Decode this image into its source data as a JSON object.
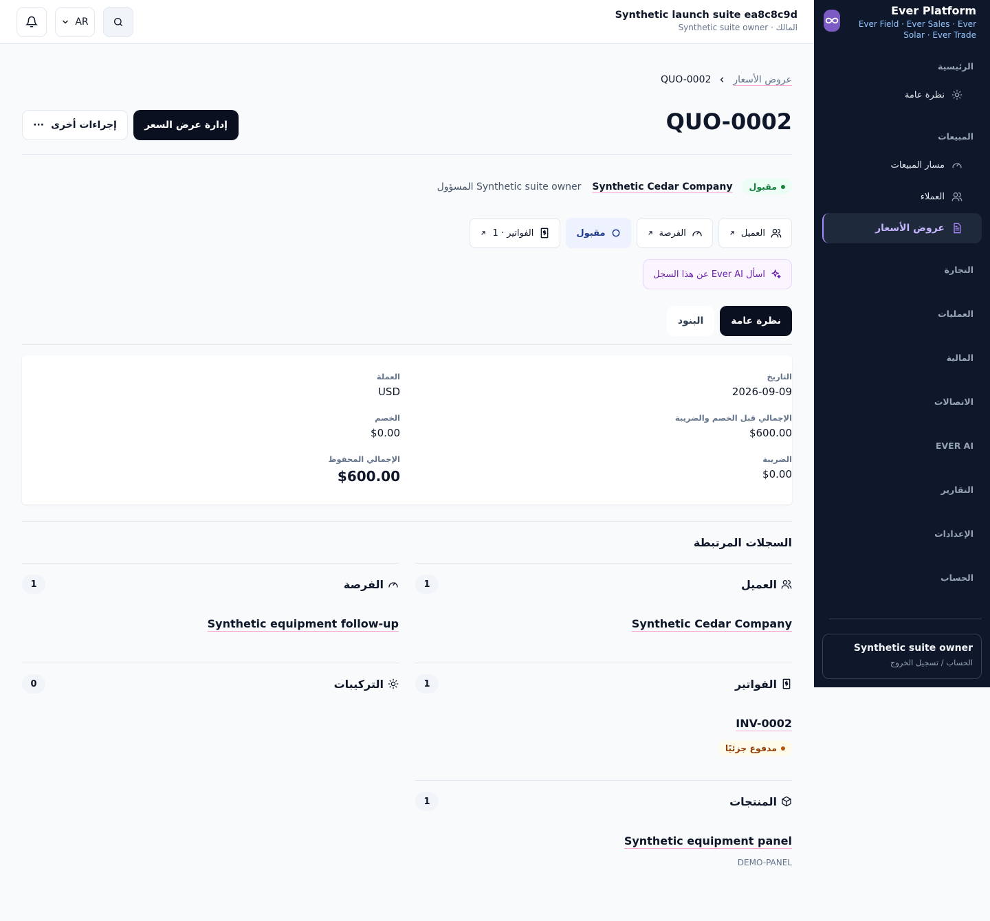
{
  "header": {
    "suite_title": "Synthetic launch suite ea8c8c9d",
    "suite_subtitle": "المالك · Synthetic suite owner",
    "language": "AR"
  },
  "brand": {
    "title": "Ever Platform",
    "subtitle": "Ever Field · Ever Sales · Ever Solar · Ever Trade"
  },
  "sidebar": {
    "sections": [
      {
        "label": "الرئيسية",
        "expanded": true
      },
      {
        "label": "المبيعات",
        "expanded": true
      },
      {
        "label": "التجارة",
        "expanded": false
      },
      {
        "label": "العمليات",
        "expanded": false
      },
      {
        "label": "المالية",
        "expanded": false
      },
      {
        "label": "الاتصالات",
        "expanded": false
      },
      {
        "label": "EVER AI",
        "expanded": false
      },
      {
        "label": "التقارير",
        "expanded": false
      },
      {
        "label": "الإعدادات",
        "expanded": false
      },
      {
        "label": "الحساب",
        "expanded": false
      }
    ],
    "items": {
      "overview": "نظرة عامة",
      "pipeline": "مسار المبيعات",
      "customers": "العملاء",
      "quotes": "عروض الأسعار"
    },
    "user": {
      "name": "Synthetic suite owner",
      "links": "الحساب / تسجيل الخروج"
    }
  },
  "breadcrumb": {
    "parent": "عروض الأسعار",
    "current": "QUO-0002"
  },
  "page": {
    "title": "QUO-0002",
    "manage_button": "إدارة عرض السعر",
    "more_actions": "إجراءات أخرى"
  },
  "meta": {
    "status": "مقبول",
    "company": "Synthetic Cedar Company",
    "owner": "Synthetic suite owner المسؤول"
  },
  "chips": {
    "customer": "العميل",
    "opportunity": "الفرصة",
    "status": "مقبول",
    "invoices": "الفواتير · 1"
  },
  "ai_button": "اسأل Ever AI عن هذا السجل",
  "tabs": {
    "overview": "نظرة عامة",
    "items": "البنود"
  },
  "summary": {
    "date": {
      "label": "التاريخ",
      "value": "2026-09-09"
    },
    "currency": {
      "label": "العملة",
      "value": "USD"
    },
    "subtotal": {
      "label": "الإجمالي قبل الخصم والضريبة",
      "value": "$600.00"
    },
    "discount": {
      "label": "الخصم",
      "value": "$0.00"
    },
    "tax": {
      "label": "الضريبة",
      "value": "$0.00"
    },
    "total": {
      "label": "الإجمالي المحفوظ",
      "value": "$600.00"
    }
  },
  "related": {
    "title": "السجلات المرتبطة",
    "customer": {
      "label": "العميل",
      "count": "1",
      "link": "Synthetic Cedar Company"
    },
    "opportunity": {
      "label": "الفرصة",
      "count": "1",
      "link": "Synthetic equipment follow-up"
    },
    "invoices": {
      "label": "الفواتير",
      "count": "1",
      "link": "INV-0002",
      "status": "مدفوع جزئيًا"
    },
    "installations": {
      "label": "التركيبات",
      "count": "0"
    },
    "products": {
      "label": "المنتجات",
      "count": "1",
      "link": "Synthetic equipment panel",
      "sku": "DEMO-PANEL"
    }
  },
  "colors": {
    "sidebar_bg": "#0f172a",
    "primary": "#0b1020",
    "accent": "#a78bfa",
    "success": "#15803d",
    "warning": "#92400e"
  }
}
